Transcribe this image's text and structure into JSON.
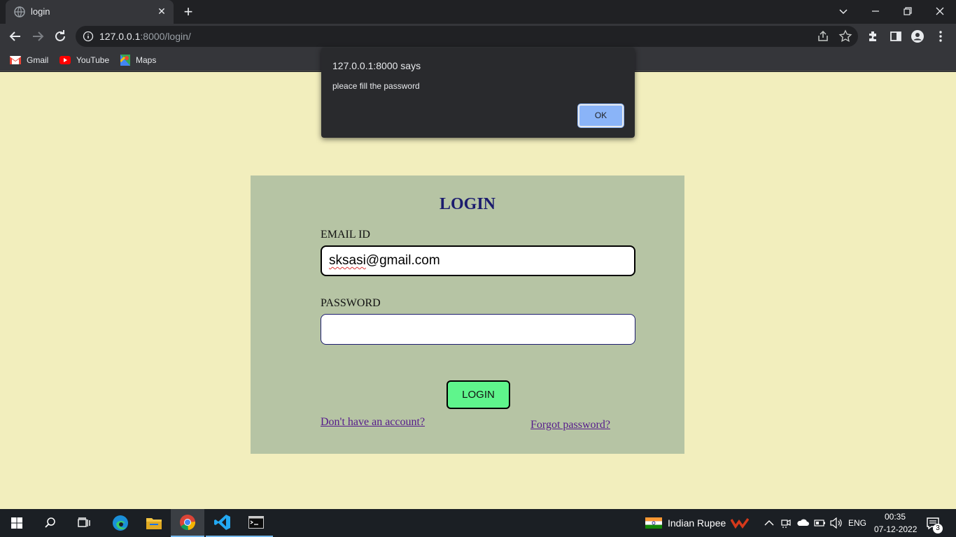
{
  "browser": {
    "tab_title": "login",
    "url_host": "127.0.0.1",
    "url_rest": ":8000/login/",
    "bookmarks": [
      {
        "label": "Gmail",
        "icon": "gmail-icon"
      },
      {
        "label": "YouTube",
        "icon": "youtube-icon"
      },
      {
        "label": "Maps",
        "icon": "maps-icon"
      }
    ]
  },
  "dialog": {
    "title": "127.0.0.1:8000 says",
    "message": "pleace fill the password",
    "ok_label": "OK"
  },
  "form": {
    "title": "LOGIN",
    "email_label": "EMAIL ID",
    "email_value_misspelled": "sksasi",
    "email_value_rest": "@gmail.com",
    "password_label": "PASSWORD",
    "password_value": "",
    "submit_label": "LOGIN",
    "signup_link": "Don't have an account?",
    "forgot_link": "Forgot password?"
  },
  "taskbar": {
    "currency_label": "Indian Rupee",
    "language": "ENG",
    "time": "00:35",
    "date": "07-12-2022",
    "notification_count": "3"
  },
  "colors": {
    "page_background": "#f2eebd",
    "card_background": "#b6c4a4",
    "login_button": "#5ff58c",
    "title_color": "#1c1c6e",
    "dialog_ok": "#8ab4f8"
  }
}
